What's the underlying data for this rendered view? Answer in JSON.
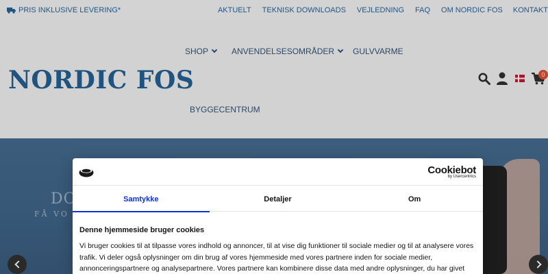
{
  "topbar": {
    "promo": "PRIS INKLUSIVE LEVERING*",
    "links": [
      "AKTUELT",
      "TEKNISK DOWNLOADS",
      "VEJLEDNING",
      "FAQ",
      "OM NORDIC FOS",
      "KONTAKT"
    ]
  },
  "header": {
    "logo": "NORDIC FOS",
    "nav": {
      "shop": "SHOP",
      "anvendelse": "ANVENDELSESOMRÅDER",
      "gulvvarme": "GULVVARME",
      "byggecentrum": "BYGGECENTRUM"
    },
    "cart_count": "0"
  },
  "hero": {
    "title": "DO",
    "subtitle": "FÅ VO"
  },
  "cookie": {
    "brand": "Cookiebot",
    "brand_sub": "by Usercentrics",
    "tabs": [
      "Samtykke",
      "Detaljer",
      "Om"
    ],
    "title": "Denne hjemmeside bruger cookies",
    "text": "Vi bruger cookies til at tilpasse vores indhold og annoncer, til at vise dig funktioner til sociale medier og til at analysere vores trafik. Vi deler også oplysninger om din brug af vores hjemmeside med vores partnere inden for sociale medier, annonceringspartnere og analysepartnere. Vores partnere kan kombinere disse data med andre oplysninger, du har givet dem, eller som de har indsamlet"
  },
  "colors": {
    "brand_blue": "#1e5e93",
    "tab_active": "#1032cf",
    "cart_badge": "#e0492e"
  }
}
